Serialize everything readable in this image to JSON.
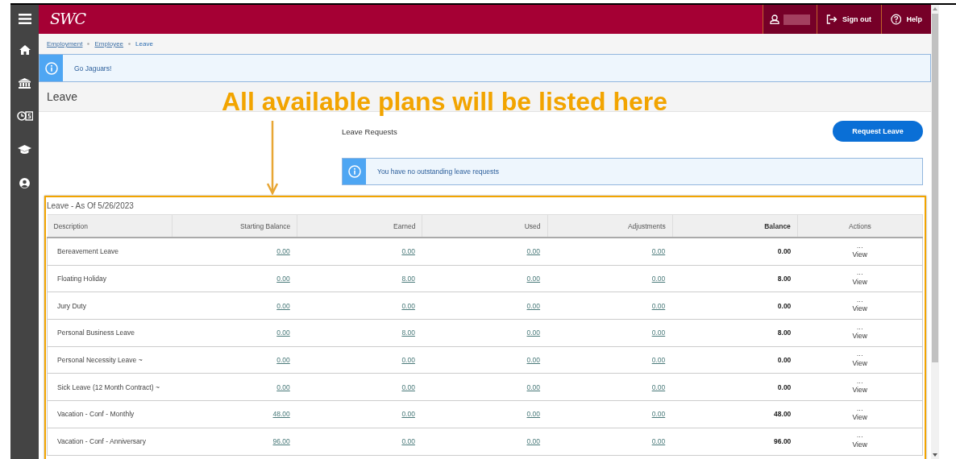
{
  "sidebar": {
    "items": [
      {
        "kind": "menu"
      },
      {
        "kind": "home"
      },
      {
        "kind": "bank"
      },
      {
        "kind": "money"
      },
      {
        "kind": "cap"
      },
      {
        "kind": "person"
      }
    ]
  },
  "header": {
    "logo": "SWC",
    "actions": [
      {
        "kind": "signout",
        "label": "Sign out"
      },
      {
        "kind": "help",
        "label": "Help"
      }
    ]
  },
  "breadcrumbs": [
    {
      "label": "Employment",
      "current": false
    },
    {
      "label": "Employee",
      "current": false
    },
    {
      "label": "Leave",
      "current": true
    }
  ],
  "notice": "Go Jaguars!",
  "page_title": "Leave",
  "annotation": "All available plans will be listed here",
  "leave_requests": {
    "title": "Leave Requests",
    "button": "Request Leave",
    "notice": "You have no outstanding leave requests"
  },
  "leave_table": {
    "caption": "Leave - As Of 5/26/2023",
    "columns": [
      {
        "label": "Description",
        "bold": false
      },
      {
        "label": "Starting Balance",
        "bold": false
      },
      {
        "label": "Earned",
        "bold": false
      },
      {
        "label": "Used",
        "bold": false
      },
      {
        "label": "Adjustments",
        "bold": false
      },
      {
        "label": "Balance",
        "bold": true
      },
      {
        "label": "Actions",
        "bold": false
      }
    ],
    "rows": [
      {
        "description": "Bereavement Leave",
        "starting_balance": "0.00",
        "earned": "0.00",
        "used": "0.00",
        "adjustments": "0.00",
        "balance": "0.00",
        "menu": "···",
        "action": "View"
      },
      {
        "description": "Floating Holiday",
        "starting_balance": "0.00",
        "earned": "8.00",
        "used": "0.00",
        "adjustments": "0.00",
        "balance": "8.00",
        "menu": "···",
        "action": "View"
      },
      {
        "description": "Jury Duty",
        "starting_balance": "0.00",
        "earned": "0.00",
        "used": "0.00",
        "adjustments": "0.00",
        "balance": "0.00",
        "menu": "···",
        "action": "View"
      },
      {
        "description": "Personal Business Leave",
        "starting_balance": "0.00",
        "earned": "8.00",
        "used": "0.00",
        "adjustments": "0.00",
        "balance": "8.00",
        "menu": "···",
        "action": "View"
      },
      {
        "description": "Personal Necessity Leave ~",
        "starting_balance": "0.00",
        "earned": "0.00",
        "used": "0.00",
        "adjustments": "0.00",
        "balance": "0.00",
        "menu": "···",
        "action": "View"
      },
      {
        "description": "Sick Leave (12 Month Contract) ~",
        "starting_balance": "0.00",
        "earned": "0.00",
        "used": "0.00",
        "adjustments": "0.00",
        "balance": "0.00",
        "menu": "···",
        "action": "View"
      },
      {
        "description": "Vacation - Conf - Monthly",
        "starting_balance": "48.00",
        "earned": "0.00",
        "used": "0.00",
        "adjustments": "0.00",
        "balance": "48.00",
        "menu": "···",
        "action": "View"
      },
      {
        "description": "Vacation - Conf - Anniversary",
        "starting_balance": "96.00",
        "earned": "0.00",
        "used": "0.00",
        "adjustments": "0.00",
        "balance": "96.00",
        "menu": "···",
        "action": "View"
      }
    ]
  }
}
